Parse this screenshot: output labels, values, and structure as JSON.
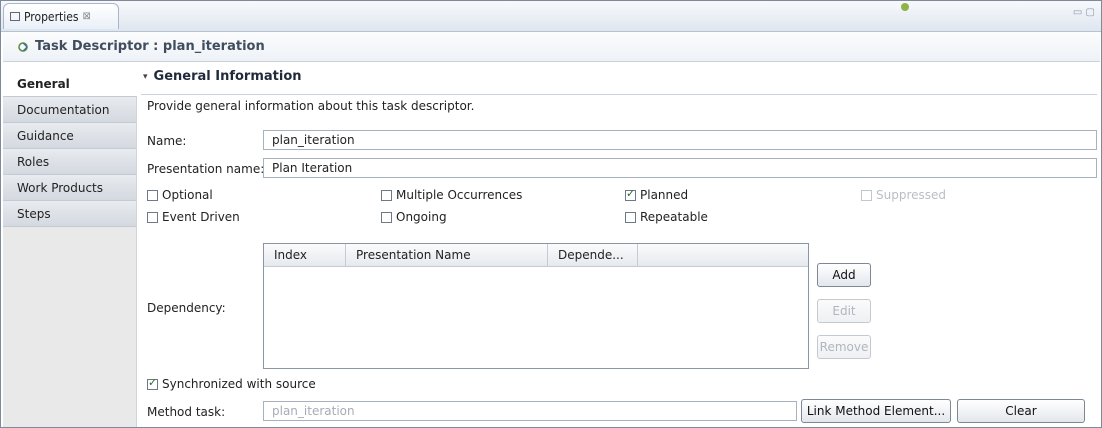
{
  "view_tab": {
    "title": "Properties",
    "close": "⊠"
  },
  "header": {
    "title": "Task Descriptor : plan_iteration"
  },
  "sidebar": {
    "tabs": [
      {
        "label": "General"
      },
      {
        "label": "Documentation"
      },
      {
        "label": "Guidance"
      },
      {
        "label": "Roles"
      },
      {
        "label": "Work Products"
      },
      {
        "label": "Steps"
      }
    ]
  },
  "section": {
    "title": "General Information",
    "description": "Provide general information about this task descriptor."
  },
  "fields": {
    "name_label": "Name:",
    "name_value": "plan_iteration",
    "presentation_label": "Presentation name:",
    "presentation_value": "Plan Iteration"
  },
  "checkboxes": {
    "optional": {
      "label": "Optional",
      "checked": false
    },
    "event_driven": {
      "label": "Event Driven",
      "checked": false
    },
    "multiple_occurrences": {
      "label": "Multiple Occurrences",
      "checked": false
    },
    "ongoing": {
      "label": "Ongoing",
      "checked": false
    },
    "planned": {
      "label": "Planned",
      "checked": true
    },
    "repeatable": {
      "label": "Repeatable",
      "checked": false
    },
    "suppressed": {
      "label": "Suppressed",
      "checked": false,
      "disabled": true
    }
  },
  "dependency": {
    "label": "Dependency:",
    "columns": [
      "Index",
      "Presentation Name",
      "Depende..."
    ],
    "buttons": {
      "add": "Add",
      "edit": "Edit",
      "remove": "Remove"
    }
  },
  "sync": {
    "label": "Synchronized with source",
    "checked": true
  },
  "method_task": {
    "label": "Method task:",
    "value": "plan_iteration",
    "link_button": "Link Method Element...",
    "clear_button": "Clear"
  },
  "colors": {
    "header_text": "#3f4d5e",
    "check_green": "#2b6a2b"
  }
}
